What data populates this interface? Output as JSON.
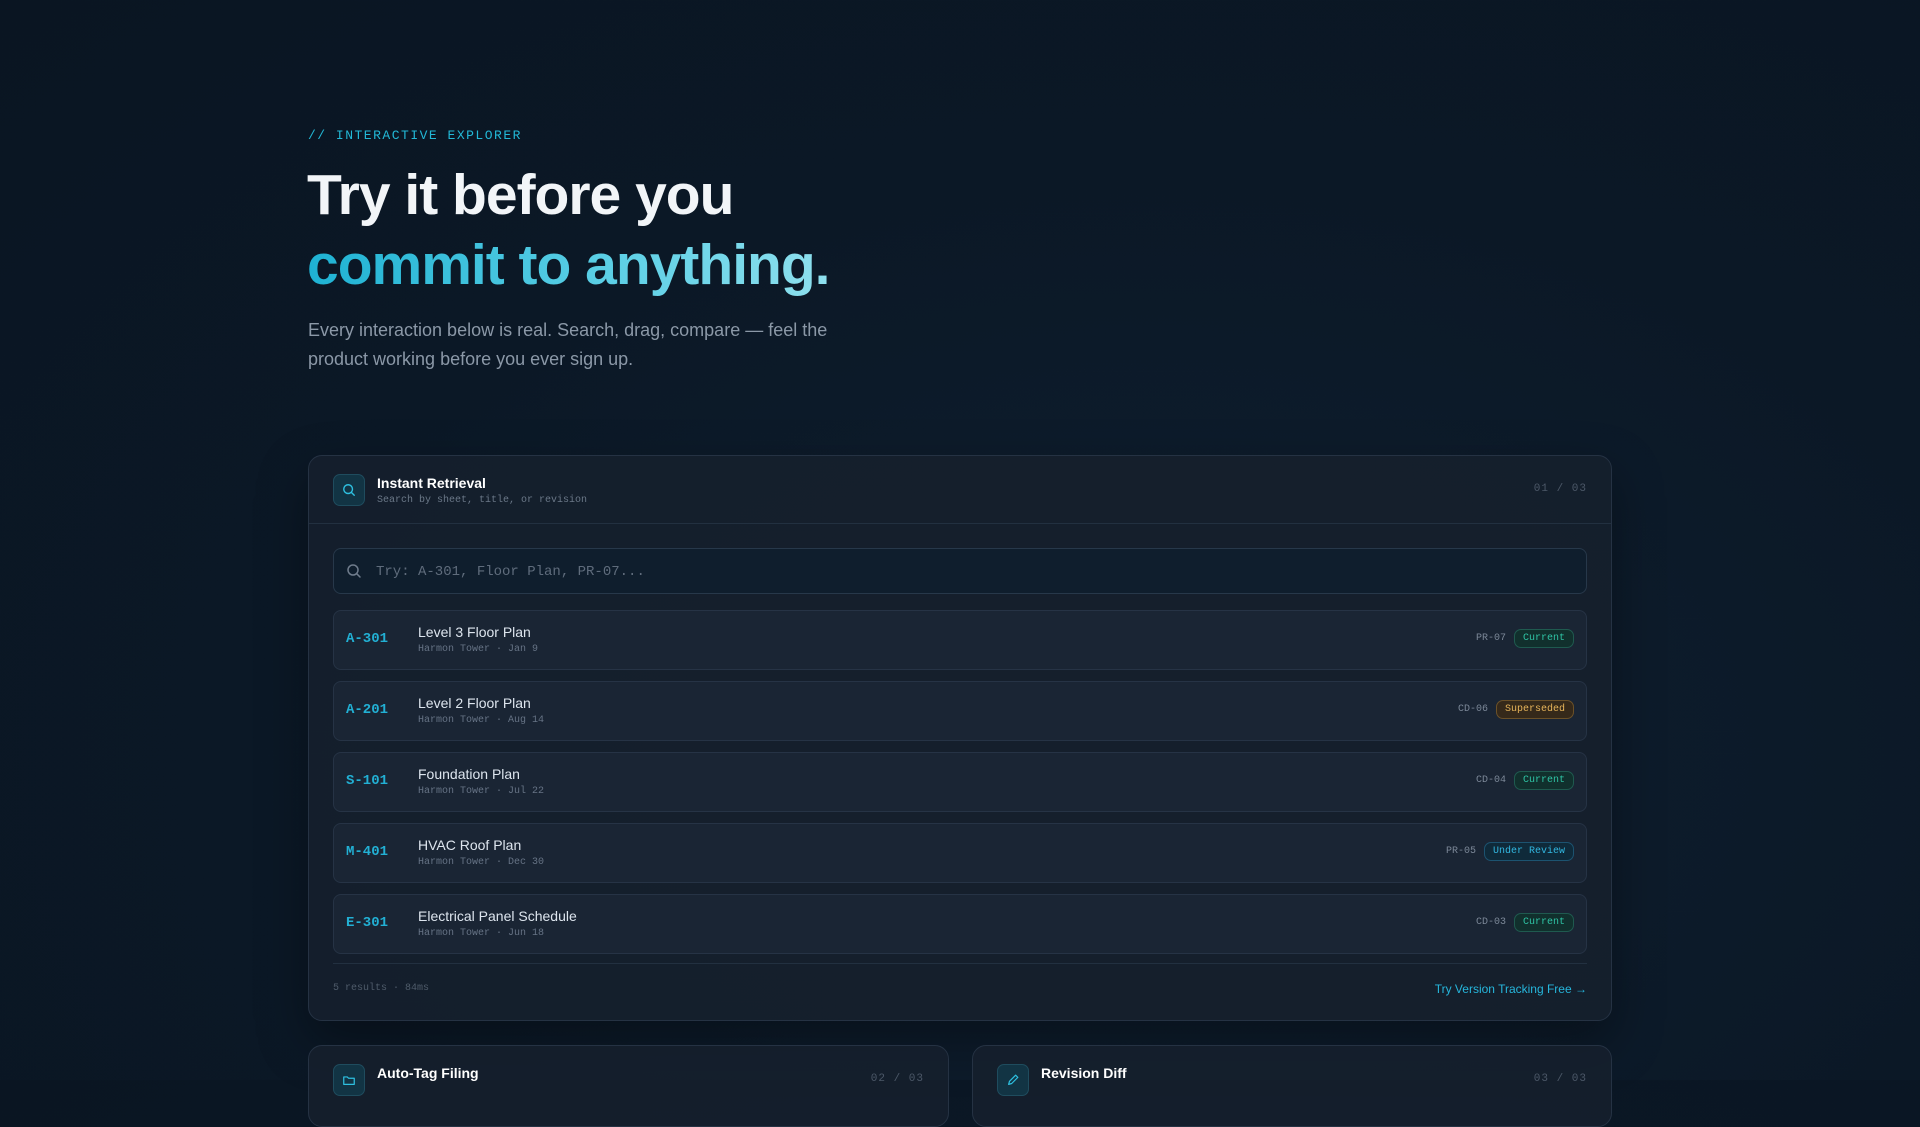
{
  "hero": {
    "eyebrow": "// INTERACTIVE EXPLORER",
    "title_line1": "Try it before you",
    "title_line2": "commit to anything.",
    "subtitle": "Every interaction below is real. Search, drag, compare — feel the product working before you ever sign up."
  },
  "retrieval": {
    "title": "Instant Retrieval",
    "subtitle": "Search by sheet, title, or revision",
    "counter": "01 / 03",
    "icon": "search-icon",
    "search": {
      "placeholder": "Try: A-301, Floor Plan, PR-07...",
      "value": ""
    },
    "results": [
      {
        "code": "A-301",
        "title": "Level 3 Floor Plan",
        "meta": "Harmon Tower · Jan 9",
        "rev": "PR-07",
        "status": "Current",
        "status_kind": "current"
      },
      {
        "code": "A-201",
        "title": "Level 2 Floor Plan",
        "meta": "Harmon Tower · Aug 14",
        "rev": "CD-06",
        "status": "Superseded",
        "status_kind": "superseded"
      },
      {
        "code": "S-101",
        "title": "Foundation Plan",
        "meta": "Harmon Tower · Jul 22",
        "rev": "CD-04",
        "status": "Current",
        "status_kind": "current"
      },
      {
        "code": "M-401",
        "title": "HVAC Roof Plan",
        "meta": "Harmon Tower · Dec 30",
        "rev": "PR-05",
        "status": "Under Review",
        "status_kind": "review"
      },
      {
        "code": "E-301",
        "title": "Electrical Panel Schedule",
        "meta": "Harmon Tower · Jun 18",
        "rev": "CD-03",
        "status": "Current",
        "status_kind": "current"
      }
    ],
    "footer_stats": "5 results · 84ms",
    "cta": "Try Version Tracking Free →"
  },
  "auto_tag": {
    "title": "Auto-Tag Filing",
    "counter": "02 / 03",
    "icon": "folder-icon"
  },
  "revision_diff": {
    "title": "Revision Diff",
    "counter": "03 / 03",
    "icon": "pencil-icon"
  },
  "colors": {
    "accent": "#22b8d6",
    "background": "#0b1826",
    "status_current": "#2fc4a5",
    "status_superseded": "#e6b45a",
    "status_review": "#32b7e0"
  }
}
